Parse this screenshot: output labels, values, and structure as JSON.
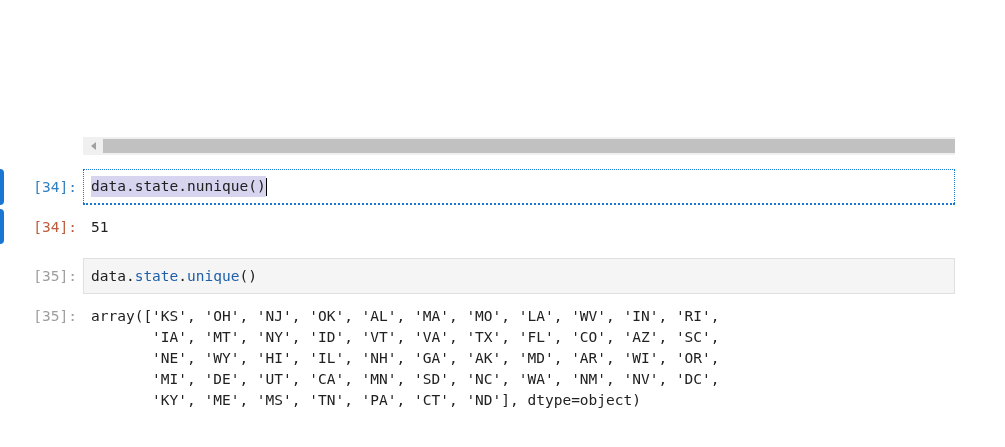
{
  "cells": [
    {
      "kind": "input",
      "prompt": "[34]:",
      "selected": true,
      "focused": true,
      "code": [
        {
          "text": "data",
          "kind": "name"
        },
        {
          "text": ".",
          "kind": "punct"
        },
        {
          "text": "state",
          "kind": "name"
        },
        {
          "text": ".",
          "kind": "punct"
        },
        {
          "text": "nunique",
          "kind": "name"
        },
        {
          "text": "()",
          "kind": "punct"
        }
      ]
    },
    {
      "kind": "output",
      "prompt": "[34]:",
      "selected": true,
      "lines": [
        "51"
      ]
    },
    {
      "kind": "input",
      "prompt": "[35]:",
      "selected": false,
      "focused": false,
      "code": [
        {
          "text": "data",
          "kind": "name"
        },
        {
          "text": ".",
          "kind": "punct"
        },
        {
          "text": "state",
          "kind": "attr"
        },
        {
          "text": ".",
          "kind": "punct"
        },
        {
          "text": "unique",
          "kind": "attr"
        },
        {
          "text": "()",
          "kind": "punct"
        }
      ]
    },
    {
      "kind": "output",
      "prompt": "[35]:",
      "selected": false,
      "lines": [
        "array(['KS', 'OH', 'NJ', 'OK', 'AL', 'MA', 'MO', 'LA', 'WV', 'IN', 'RI',",
        "       'IA', 'MT', 'NY', 'ID', 'VT', 'VA', 'TX', 'FL', 'CO', 'AZ', 'SC',",
        "       'NE', 'WY', 'HI', 'IL', 'NH', 'GA', 'AK', 'MD', 'AR', 'WI', 'OR',",
        "       'MI', 'DE', 'UT', 'CA', 'MN', 'SD', 'NC', 'WA', 'NM', 'NV', 'DC',",
        "       'KY', 'ME', 'MS', 'TN', 'PA', 'CT', 'ND'], dtype=object)"
      ]
    }
  ]
}
